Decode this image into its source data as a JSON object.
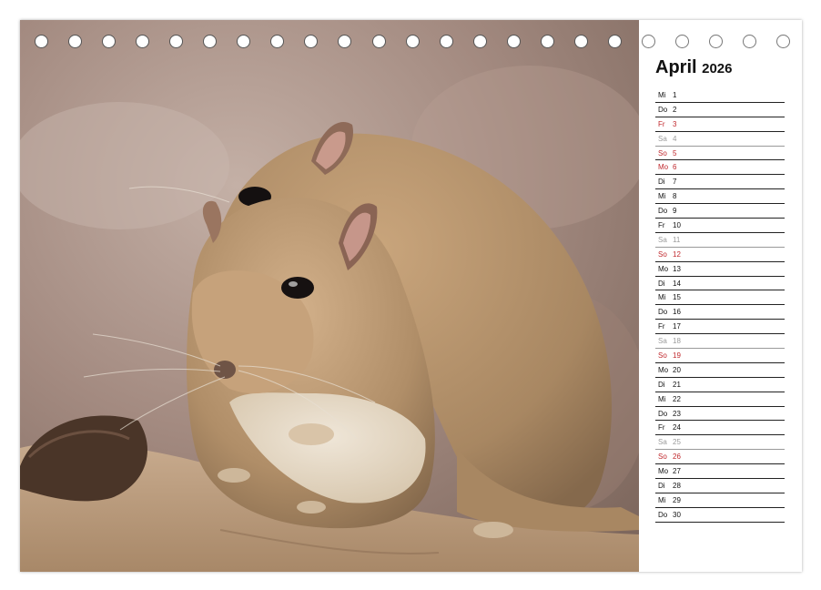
{
  "calendar": {
    "month": "April",
    "year": "2026",
    "days": [
      {
        "wd": "Mi",
        "d": "1",
        "type": "normal"
      },
      {
        "wd": "Do",
        "d": "2",
        "type": "normal"
      },
      {
        "wd": "Fr",
        "d": "3",
        "type": "holiday"
      },
      {
        "wd": "Sa",
        "d": "4",
        "type": "saturday"
      },
      {
        "wd": "So",
        "d": "5",
        "type": "sunday"
      },
      {
        "wd": "Mo",
        "d": "6",
        "type": "holiday"
      },
      {
        "wd": "Di",
        "d": "7",
        "type": "normal"
      },
      {
        "wd": "Mi",
        "d": "8",
        "type": "normal"
      },
      {
        "wd": "Do",
        "d": "9",
        "type": "normal"
      },
      {
        "wd": "Fr",
        "d": "10",
        "type": "normal"
      },
      {
        "wd": "Sa",
        "d": "11",
        "type": "saturday"
      },
      {
        "wd": "So",
        "d": "12",
        "type": "sunday"
      },
      {
        "wd": "Mo",
        "d": "13",
        "type": "normal"
      },
      {
        "wd": "Di",
        "d": "14",
        "type": "normal"
      },
      {
        "wd": "Mi",
        "d": "15",
        "type": "normal"
      },
      {
        "wd": "Do",
        "d": "16",
        "type": "normal"
      },
      {
        "wd": "Fr",
        "d": "17",
        "type": "normal"
      },
      {
        "wd": "Sa",
        "d": "18",
        "type": "saturday"
      },
      {
        "wd": "So",
        "d": "19",
        "type": "sunday"
      },
      {
        "wd": "Mo",
        "d": "20",
        "type": "normal"
      },
      {
        "wd": "Di",
        "d": "21",
        "type": "normal"
      },
      {
        "wd": "Mi",
        "d": "22",
        "type": "normal"
      },
      {
        "wd": "Do",
        "d": "23",
        "type": "normal"
      },
      {
        "wd": "Fr",
        "d": "24",
        "type": "normal"
      },
      {
        "wd": "Sa",
        "d": "25",
        "type": "saturday"
      },
      {
        "wd": "So",
        "d": "26",
        "type": "sunday"
      },
      {
        "wd": "Mo",
        "d": "27",
        "type": "normal"
      },
      {
        "wd": "Di",
        "d": "28",
        "type": "normal"
      },
      {
        "wd": "Mi",
        "d": "29",
        "type": "normal"
      },
      {
        "wd": "Do",
        "d": "30",
        "type": "normal"
      }
    ]
  },
  "photo": {
    "subject": "gerbils-photo"
  },
  "colors": {
    "sunday_holiday": "#c0282d",
    "saturday": "#9a9a9a",
    "text": "#111111"
  }
}
